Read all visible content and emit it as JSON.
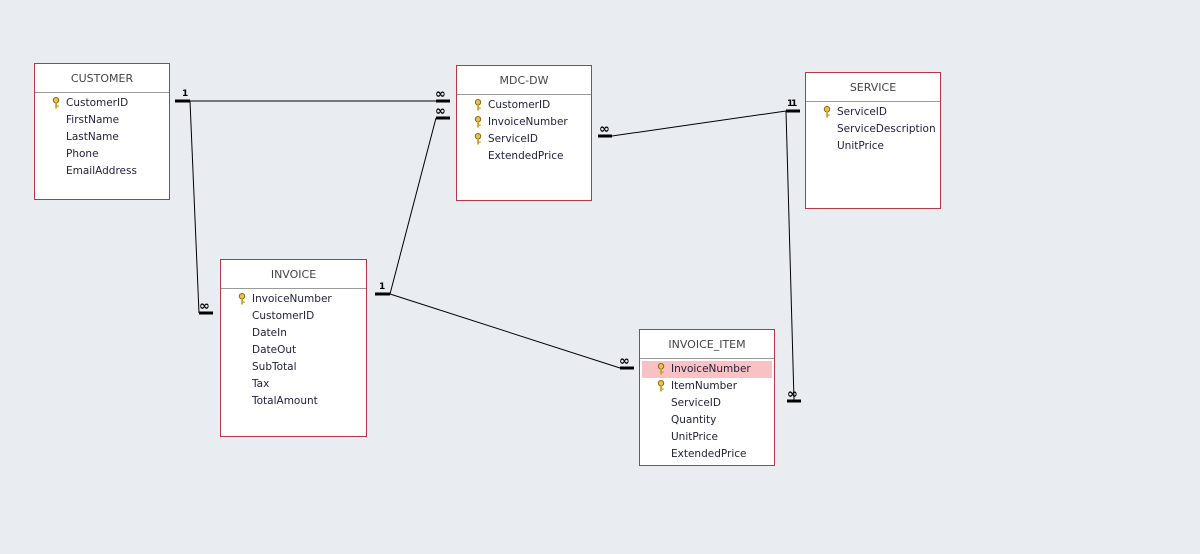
{
  "tables": [
    {
      "title": "CUSTOMER",
      "fields": [
        {
          "name": "CustomerID",
          "key": true
        },
        {
          "name": "FirstName"
        },
        {
          "name": "LastName"
        },
        {
          "name": "Phone"
        },
        {
          "name": "EmailAddress"
        }
      ]
    },
    {
      "title": "MDC-DW",
      "fields": [
        {
          "name": "CustomerID",
          "key": true
        },
        {
          "name": "InvoiceNumber",
          "key": true
        },
        {
          "name": "ServiceID",
          "key": true
        },
        {
          "name": "ExtendedPrice"
        }
      ]
    },
    {
      "title": "SERVICE",
      "fields": [
        {
          "name": "ServiceID",
          "key": true
        },
        {
          "name": "ServiceDescription"
        },
        {
          "name": "UnitPrice"
        }
      ]
    },
    {
      "title": "INVOICE",
      "fields": [
        {
          "name": "InvoiceNumber",
          "key": true
        },
        {
          "name": "CustomerID"
        },
        {
          "name": "DateIn"
        },
        {
          "name": "DateOut"
        },
        {
          "name": "SubTotal"
        },
        {
          "name": "Tax"
        },
        {
          "name": "TotalAmount"
        }
      ]
    },
    {
      "title": "INVOICE_ITEM",
      "fields": [
        {
          "name": "InvoiceNumber",
          "key": true,
          "selected": true
        },
        {
          "name": "ItemNumber",
          "key": true
        },
        {
          "name": "ServiceID"
        },
        {
          "name": "Quantity"
        },
        {
          "name": "UnitPrice"
        },
        {
          "name": "ExtendedPrice"
        }
      ]
    }
  ],
  "relationships": [
    {
      "from": "CUSTOMER",
      "to": "MDC-DW",
      "one": "1",
      "many": "∞"
    },
    {
      "from": "CUSTOMER",
      "to": "INVOICE",
      "one": "1",
      "many": "∞"
    },
    {
      "from": "INVOICE",
      "to": "MDC-DW",
      "one": "1",
      "many": "∞"
    },
    {
      "from": "INVOICE",
      "to": "INVOICE_ITEM",
      "one": "1",
      "many": "∞"
    },
    {
      "from": "SERVICE",
      "to": "MDC-DW",
      "one": "1",
      "many": "∞"
    },
    {
      "from": "SERVICE",
      "to": "INVOICE_ITEM",
      "one": "1",
      "many": "∞"
    }
  ],
  "colors": {
    "table_border": "#b33a45",
    "selected_row": "#f8c1c4",
    "canvas": "#e9edf1"
  }
}
